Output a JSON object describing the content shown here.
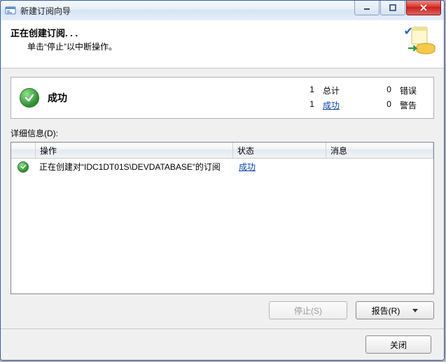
{
  "window": {
    "title": "新建订阅向导"
  },
  "header": {
    "heading": "正在创建订阅. . .",
    "subheading": "单击“停止”以中断操作。"
  },
  "summary": {
    "status_label": "成功",
    "total_count": "1",
    "total_label": "总计",
    "success_count": "1",
    "success_label": "成功",
    "error_count": "0",
    "error_label": "错误",
    "warning_count": "0",
    "warning_label": "警告"
  },
  "details": {
    "label": "详细信息(D):",
    "columns": {
      "action": "操作",
      "status": "状态",
      "message": "消息"
    },
    "rows": [
      {
        "action": "正在创建对“IDC1DT01S\\DEVDATABASE”的订阅",
        "status": "成功",
        "message": ""
      }
    ]
  },
  "buttons": {
    "stop": "停止(S)",
    "report": "报告(R)",
    "close": "关闭"
  }
}
